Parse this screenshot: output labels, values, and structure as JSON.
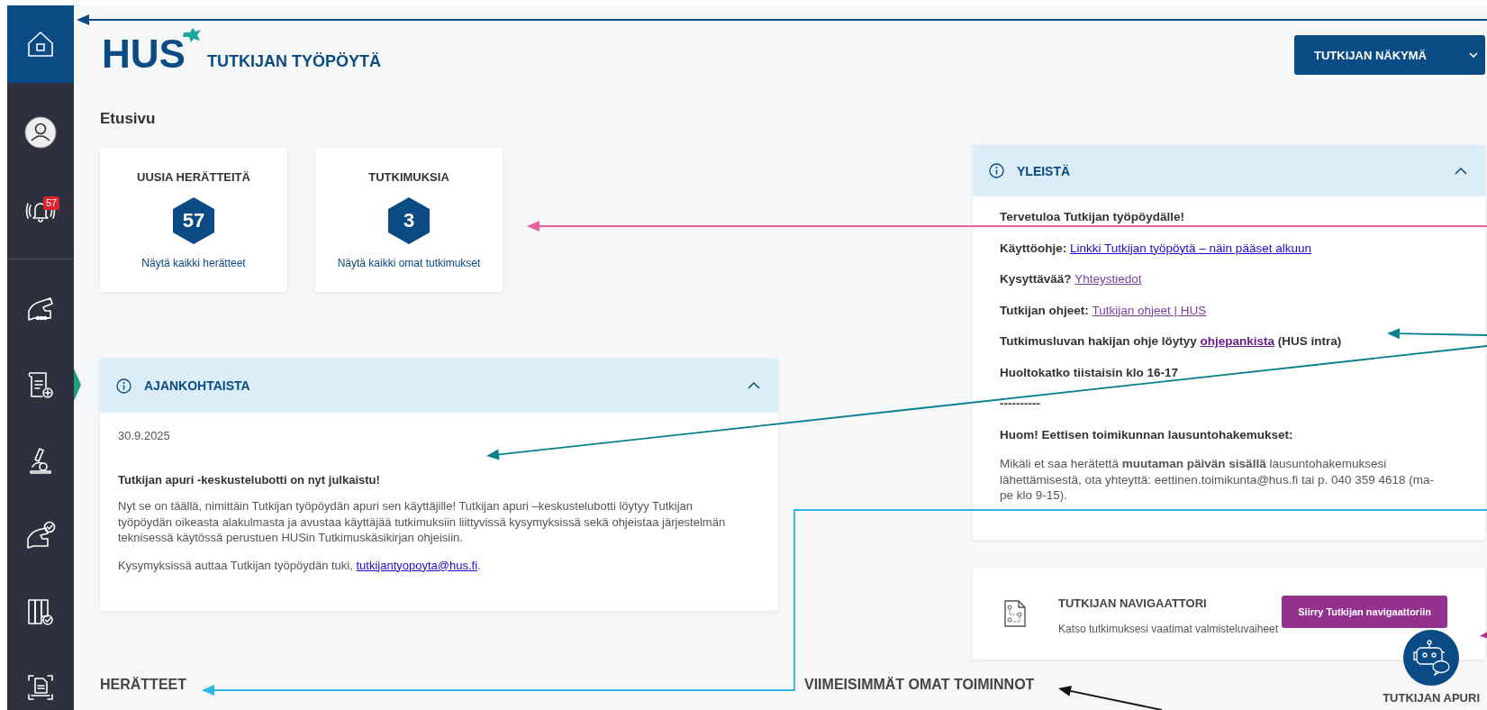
{
  "sidebar": {
    "groups": [
      {
        "items": [
          {
            "kind": "home",
            "selected": true,
            "highlighted": false
          },
          {
            "kind": "profile",
            "selected": false,
            "highlighted": false
          },
          {
            "kind": "alerts",
            "badge": "57",
            "selected": false,
            "highlighted": false
          }
        ]
      },
      {
        "items": [
          {
            "kind": "samples",
            "selected": false,
            "highlighted": false
          },
          {
            "kind": "new-application",
            "selected": false,
            "highlighted": true
          },
          {
            "kind": "research",
            "selected": false,
            "highlighted": false
          },
          {
            "kind": "approved-samples",
            "selected": false,
            "highlighted": false
          },
          {
            "kind": "library",
            "selected": false,
            "highlighted": false
          },
          {
            "kind": "scan",
            "selected": false,
            "highlighted": false
          }
        ]
      }
    ]
  },
  "logo": {
    "text": "HUS"
  },
  "app_title": "TUTKIJAN TYÖPÖYTÄ",
  "view_menu": {
    "label": "TUTKIJAN NÄKYMÄ"
  },
  "page_title": "Etusivu",
  "summary_cards": [
    {
      "title": "UUSIA HERÄTTEITÄ",
      "count": "57",
      "link": "Näytä kaikki herätteet"
    },
    {
      "title": "TUTKIMUKSIA",
      "count": "3",
      "link": "Näytä kaikki omat tutkimukset"
    }
  ],
  "news_panel": {
    "title": "AJANKOHTAISTA",
    "expanded": true,
    "date": "30.9.2025",
    "headline": "Tutkijan apuri -keskustelubotti on nyt julkaistu!",
    "paragraphs": [
      {
        "text": "Nyt se on täällä, nimittäin Tutkijan työpöydän apuri sen käyttäjille! Tutkijan apuri –keskustelubotti löytyy Tutkijan työpöydän oikeasta alakulmasta ja avustaa käyttäjää tutkimuksiin liittyvissä kysymyksissä sekä ohjeistaa järjestelmän teknisessä käytössä perustuen HUSin Tutkimuskäsikirjan ohjeisiin."
      },
      {
        "text": "Kysymyksissä auttaa Tutkijan työpöydän tuki,",
        "link": "tutkijantyopoyta@hus.fi",
        "after": "."
      }
    ]
  },
  "general_panel": {
    "title": "YLEISTÄ",
    "expanded": true,
    "lines": [
      {
        "kind": "heading",
        "text": "Tervetuloa Tutkijan työpöydälle!"
      },
      {
        "kind": "link-line",
        "label": "Käyttöohje:",
        "link": "Linkki Tutkijan työpöytä – näin pääset alkuun",
        "visited": false,
        "strong": false
      },
      {
        "kind": "link-line",
        "label": "Kysyttävää?",
        "link": "Yhteystiedot",
        "visited": true,
        "strong": false
      },
      {
        "kind": "link-line",
        "label": "Tutkijan ohjeet:",
        "link": "Tutkijan ohjeet | HUS",
        "visited": true,
        "strong": false
      },
      {
        "kind": "link-line",
        "label": "Tutkimusluvan hakijan ohje löytyy",
        "link": "ohjepankista",
        "after": "(HUS intra)",
        "visited": true,
        "strong": true
      },
      {
        "kind": "heading",
        "text": "Huoltokatko tiistaisin klo 16-17"
      },
      {
        "kind": "heading",
        "text": "----------"
      },
      {
        "kind": "heading",
        "text": "Huom! Eettisen toimikunnan lausuntohakemukset:"
      },
      {
        "kind": "paragraph",
        "text": "Mikäli et saa herätettä **muutaman päivän sisällä** lausuntohakemuksesi lähettämisestä, ota yhteyttä: eettinen.toimikunta@hus.fi tai p. 040 359 4618 (ma-pe klo 9-15)."
      }
    ]
  },
  "navigator": {
    "title": "TUTKIJAN NAVIGAATTORI",
    "text": "Katso tutkimuksesi vaatimat valmisteluvaiheet",
    "button": "Siirry Tutkijan navigaattoriin"
  },
  "section_headings": [
    "HERÄTTEET",
    "VIIMEISIMMÄT OMAT TOIMINNOT"
  ],
  "chatbot": {
    "label": "TUTKIJAN APURI"
  },
  "annotation_arrows": [
    {
      "color": "#0f4a86"
    },
    {
      "color": "#e6609f"
    },
    {
      "color": "#08808e"
    },
    {
      "color": "#08808e"
    },
    {
      "color": "#2bb6e8"
    },
    {
      "color": "#b0307f"
    },
    {
      "color": "#111111"
    }
  ]
}
